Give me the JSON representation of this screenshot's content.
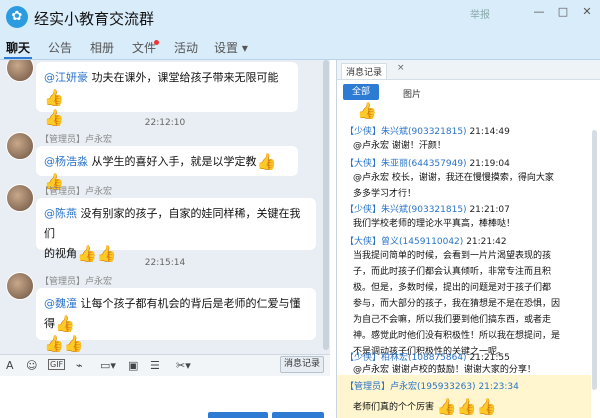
{
  "window": {
    "title": "经实小教育交流群",
    "report": "举报",
    "controls": [
      "—",
      "□",
      "✕"
    ]
  },
  "tabs": [
    "聊天",
    "公告",
    "相册",
    "文件",
    "活动",
    "设置 ▾"
  ],
  "chat": {
    "messages": [
      {
        "mention": "@江妍豪",
        "text": " 功夫在课外，课堂给孩子带来无限可能",
        "thumbs_inline": 1,
        "thumbs_line2": 1
      },
      {
        "timestamp": "22:12:10"
      },
      {
        "sender": "【管理员】卢永宏",
        "mention": "@杨浩淼",
        "text": " 从学生的喜好入手，就是以学定教",
        "thumbs_inline": 2
      },
      {
        "sender": "【管理员】卢永宏",
        "mention": "@陈燕",
        "text_line1": " 没有别家的孩子，自家的娃同样稀，关键在我们",
        "text_line2": "的视角",
        "thumbs_line2": 2
      },
      {
        "timestamp": "22:15:14"
      },
      {
        "sender": "【管理员】卢永宏",
        "mention": "@魏潼",
        "text_line1": " 让每个孩子都有机会的背后是老师的仁爱与懂得",
        "thumbs_line1": 1,
        "thumbs_line2": 2
      }
    ]
  },
  "toolbar": {
    "icons": [
      "font-icon",
      "emoji-icon",
      "gif-icon",
      "shake-icon",
      "image-icon",
      "picture-icon",
      "more-icon",
      "scissors-icon"
    ],
    "history_label": "消息记录 ▾"
  },
  "panel": {
    "tab_label": "消息记录",
    "close": "×",
    "filter_all": "全部",
    "filter_images": "图片",
    "entries": [
      {
        "role": "【少侠】",
        "nick": "朱兴斌(903321815)",
        "time": "21:14:49",
        "body": [
          "@卢永宏 谢谢！汗颜！"
        ]
      },
      {
        "role": "【大侠】",
        "nick": "朱亚丽(644357949)",
        "time": "21:19:04",
        "body": [
          "@卢永宏 校长，谢谢，我还在慢慢摸索，得向大家",
          "多多学习才行！"
        ]
      },
      {
        "role": "【少侠】",
        "nick": "朱兴斌(903321815)",
        "time": "21:21:07",
        "body": [
          "我们学校老师的理论水平真高，棒棒哒！"
        ]
      },
      {
        "role": "【大侠】",
        "nick": "曾义(1459110042)",
        "time": "21:21:42",
        "body": [
          "当我提问简单的时候，会看到一片片渴望表现的孩",
          "子，而此时孩子们都会认真倾听，非常专注而且积",
          "极。但是，多数时候，提出的问题是对于孩子们都",
          "参与，而大部分的孩子，我在猜想是不是在恐惧，因",
          "为自己不会嘛，所以我们要到他们搞东西，或者走",
          "神。感觉此时他们没有积极性！所以我在想提问，是",
          "不是调动孩子们积极性的关键之一呢。"
        ]
      },
      {
        "role": "【少侠】",
        "nick": "柏林宏(108875864)",
        "time": "21:21:55",
        "body": [
          "@卢永宏 谢谢卢校的鼓励！谢谢大家的分享！"
        ]
      },
      {
        "role": "【管理员】",
        "nick": "卢永宏(195933263)",
        "time": "21:23:34",
        "body": [
          "老师们真的个个厉害"
        ],
        "highlight": true
      }
    ]
  },
  "colors": {
    "accent": "#2d7bd3",
    "title_bg": "#d9ecfa",
    "chat_bg": "#e8eef3",
    "highlight": "#fff6cf"
  }
}
